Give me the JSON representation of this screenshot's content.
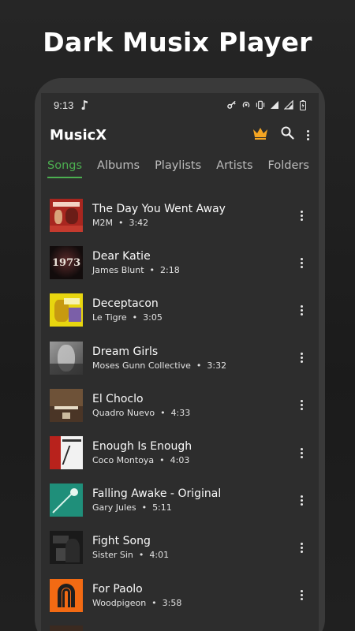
{
  "promo": {
    "title": "Dark Musix Player"
  },
  "status": {
    "time": "9:13"
  },
  "app": {
    "title": "MusicX"
  },
  "tabs": [
    {
      "label": "Songs",
      "active": true
    },
    {
      "label": "Albums",
      "active": false
    },
    {
      "label": "Playlists",
      "active": false
    },
    {
      "label": "Artists",
      "active": false
    },
    {
      "label": "Folders",
      "active": false
    }
  ],
  "songs": [
    {
      "title": "The Day You Went Away",
      "artist": "M2M",
      "duration": "3:42",
      "art": "album-cover-red"
    },
    {
      "title": "Dear Katie",
      "artist": "James Blunt",
      "duration": "2:18",
      "art": "album-cover-1973"
    },
    {
      "title": "Deceptacon",
      "artist": "Le Tigre",
      "duration": "3:05",
      "art": "album-cover-yellow"
    },
    {
      "title": "Dream Girls",
      "artist": "Moses Gunn Collective",
      "duration": "3:32",
      "art": "album-cover-gray"
    },
    {
      "title": "El Choclo",
      "artist": "Quadro Nuevo",
      "duration": "4:33",
      "art": "album-cover-brown"
    },
    {
      "title": "Enough Is Enough",
      "artist": "Coco Montoya",
      "duration": "4:03",
      "art": "album-cover-white"
    },
    {
      "title": "Falling Awake - Original",
      "artist": "Gary Jules",
      "duration": "5:11",
      "art": "album-cover-teal"
    },
    {
      "title": "Fight Song",
      "artist": "Sister Sin",
      "duration": "4:01",
      "art": "album-cover-dark"
    },
    {
      "title": "For Paolo",
      "artist": "Woodpigeon",
      "duration": "3:58",
      "art": "album-cover-orange"
    }
  ],
  "colors": {
    "accent": "#4caf50",
    "crown": "#f5a623",
    "background": "#2d2d2d"
  }
}
